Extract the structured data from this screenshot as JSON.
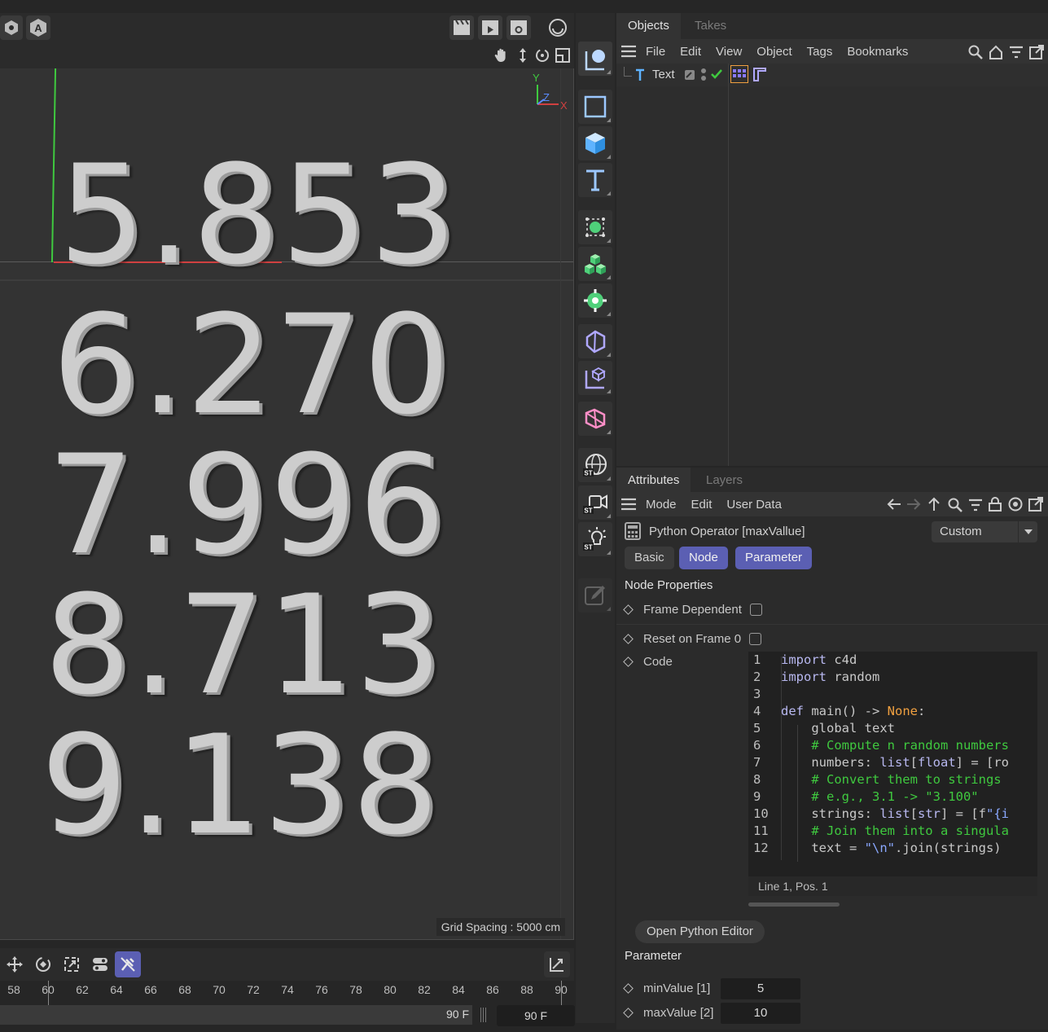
{
  "viewport": {
    "numbers": [
      "5.853",
      "6.270",
      "7.996",
      "8.713",
      "9.138"
    ],
    "grid_spacing": "Grid Spacing : 5000 cm",
    "axis_labels": {
      "y": "Y",
      "z": "Z",
      "x": "X"
    }
  },
  "timeline": {
    "ticks": [
      "58",
      "60",
      "62",
      "64",
      "66",
      "68",
      "70",
      "72",
      "74",
      "76",
      "78",
      "80",
      "82",
      "84",
      "86",
      "88",
      "90"
    ],
    "current_frame": "90 F",
    "end_frame": "90 F"
  },
  "objects_panel": {
    "tabs": [
      "Objects",
      "Takes"
    ],
    "menu": [
      "File",
      "Edit",
      "View",
      "Object",
      "Tags",
      "Bookmarks"
    ],
    "object_name": "Text"
  },
  "attributes_panel": {
    "tabs": [
      "Attributes",
      "Layers"
    ],
    "menu": [
      "Mode",
      "Edit",
      "User Data"
    ],
    "title": "Python Operator [maxVallue]",
    "preset": "Custom",
    "subtabs": [
      "Basic",
      "Node",
      "Parameter"
    ],
    "section_node": "Node Properties",
    "frame_dependent": "Frame Dependent",
    "reset_frame": "Reset on Frame 0",
    "code_label": "Code",
    "code_lines": [
      "import c4d",
      "import random",
      "",
      "def main() -> None:",
      "    global text",
      "    # Compute n random numbers",
      "    numbers: list[float] = [ro",
      "    # Convert them to strings",
      "    # e.g., 3.1 -> \"3.100\"",
      "    strings: list[str] = [f\"{i",
      "    # Join them into a singula",
      "    text = \"\\n\".join(strings)"
    ],
    "code_status": "Line 1, Pos. 1",
    "open_editor": "Open Python Editor",
    "section_param": "Parameter",
    "min_label": "minValue [1]",
    "min_value": "5",
    "max_label": "maxValue [2]",
    "max_value": "10"
  },
  "colors": {
    "accent": "#5b5fb3",
    "axis_x": "#d04040",
    "axis_y": "#3fc93f",
    "axis_z": "#5a8cff"
  }
}
